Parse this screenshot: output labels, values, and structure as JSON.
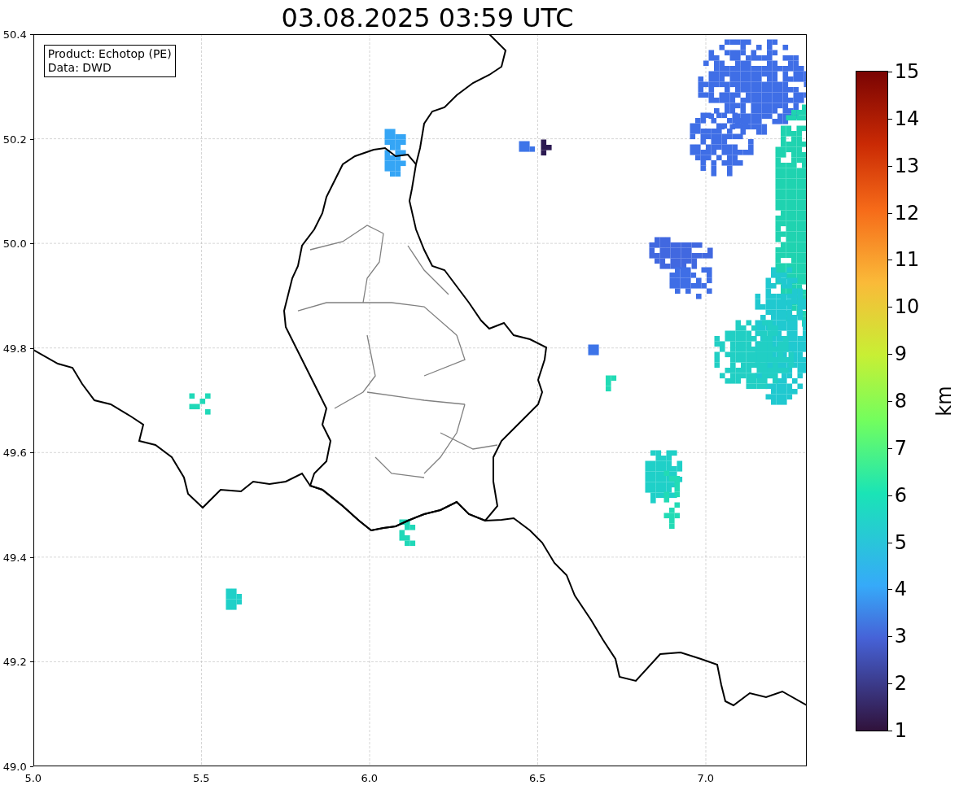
{
  "title": "03.08.2025 03:59 UTC",
  "info_box": {
    "lines": [
      "Product: Echotop (PE)",
      "Data: DWD"
    ]
  },
  "map": {
    "y_ticks": [
      "50.4",
      "50.2",
      "50.0",
      "49.8",
      "49.6",
      "49.4",
      "49.2",
      "49.0"
    ],
    "x_ticks": [
      "5.0",
      "5.5",
      "6.0",
      "6.5",
      "7.0"
    ]
  },
  "colorbar": {
    "label": "km",
    "ticks": [
      "15",
      "14",
      "13",
      "12",
      "11",
      "10",
      "9",
      "8",
      "7",
      "6",
      "5",
      "4",
      "3",
      "2",
      "1"
    ]
  }
}
